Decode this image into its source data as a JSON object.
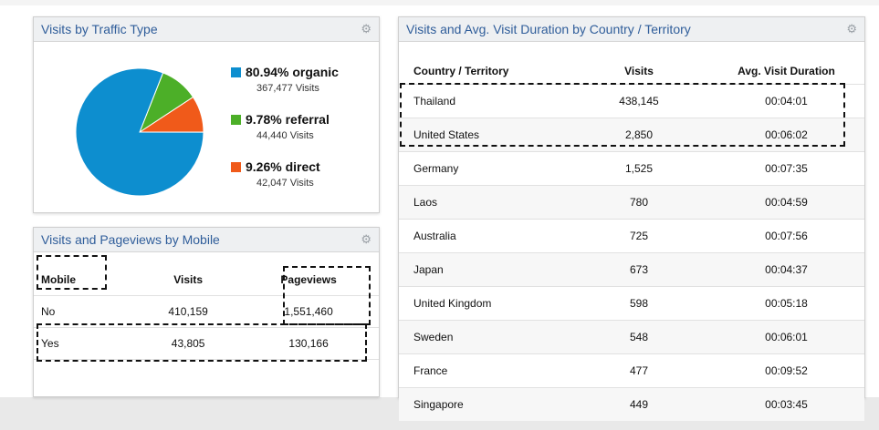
{
  "traffic_panel": {
    "title": "Visits by Traffic Type",
    "legend": [
      {
        "label": "80.94% organic",
        "sub": "367,477 Visits",
        "color": "#0d8ecf",
        "share": 0.8094
      },
      {
        "label": "9.78% referral",
        "sub": "44,440 Visits",
        "color": "#4caf28",
        "share": 0.0978
      },
      {
        "label": "9.26% direct",
        "sub": "42,047 Visits",
        "color": "#f05a1a",
        "share": 0.0926
      }
    ]
  },
  "mobile_panel": {
    "title": "Visits and Pageviews by Mobile",
    "headers": [
      "Mobile",
      "Visits",
      "Pageviews"
    ],
    "rows": [
      [
        "No",
        "410,159",
        "1,551,460"
      ],
      [
        "Yes",
        "43,805",
        "130,166"
      ]
    ]
  },
  "country_panel": {
    "title": "Visits and Avg. Visit Duration by Country / Territory",
    "headers": [
      "Country / Territory",
      "Visits",
      "Avg. Visit Duration"
    ],
    "rows": [
      [
        "Thailand",
        "438,145",
        "00:04:01"
      ],
      [
        "United States",
        "2,850",
        "00:06:02"
      ],
      [
        "Germany",
        "1,525",
        "00:07:35"
      ],
      [
        "Laos",
        "780",
        "00:04:59"
      ],
      [
        "Australia",
        "725",
        "00:07:56"
      ],
      [
        "Japan",
        "673",
        "00:04:37"
      ],
      [
        "United Kingdom",
        "598",
        "00:05:18"
      ],
      [
        "Sweden",
        "548",
        "00:06:01"
      ],
      [
        "France",
        "477",
        "00:09:52"
      ],
      [
        "Singapore",
        "449",
        "00:03:45"
      ]
    ]
  },
  "icons": {
    "settings": "gear-icon"
  }
}
